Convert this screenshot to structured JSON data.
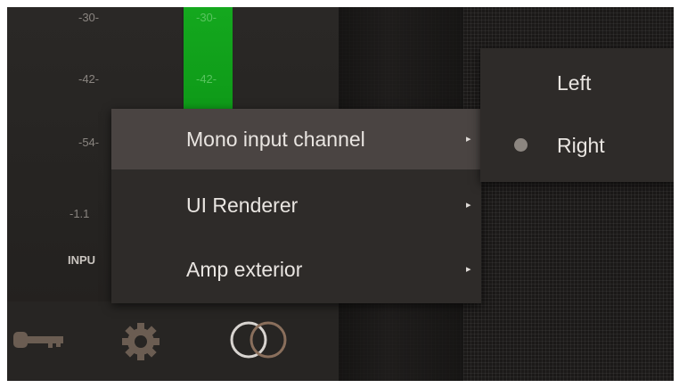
{
  "meter": {
    "left_ticks": [
      "-30-",
      "-42-",
      "-54-",
      "-1.1"
    ],
    "green_ticks": [
      "-30-",
      "-42-"
    ],
    "input_label": "INPU"
  },
  "toolbar": {
    "icons": [
      "key-icon",
      "gear-icon",
      "stereo-rings-icon"
    ]
  },
  "context_menu": {
    "items": [
      {
        "label": "Mono input channel",
        "has_submenu": true,
        "active": true
      },
      {
        "label": "UI Renderer",
        "has_submenu": true,
        "active": false
      },
      {
        "label": "Amp exterior",
        "has_submenu": true,
        "active": false
      }
    ],
    "submenu_arrow": "▸"
  },
  "submenu": {
    "items": [
      {
        "label": "Left",
        "selected": false
      },
      {
        "label": "Right",
        "selected": true
      }
    ]
  },
  "colors": {
    "menu_bg": "#2e2b29",
    "menu_active_bg": "#4a4442",
    "meter_green": "#14a81e",
    "radio_dot": "#8c8680"
  }
}
